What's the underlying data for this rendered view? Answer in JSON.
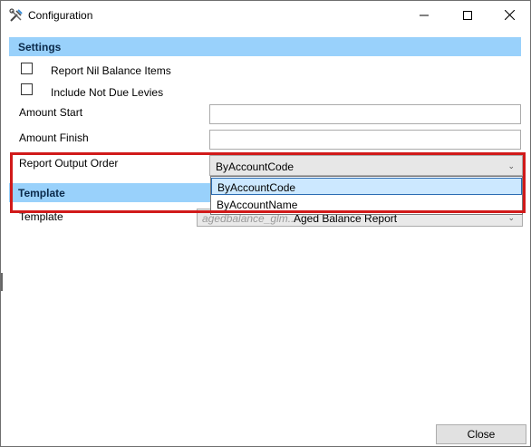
{
  "window": {
    "title": "Configuration"
  },
  "settings": {
    "header": "Settings",
    "report_nil_balance": {
      "label": "Report Nil Balance Items",
      "checked": false
    },
    "include_not_due": {
      "label": "Include Not Due Levies",
      "checked": false
    },
    "amount_start": {
      "label": "Amount Start",
      "value": ""
    },
    "amount_finish": {
      "label": "Amount Finish",
      "value": ""
    },
    "report_output_order": {
      "label": "Report Output Order",
      "selected": "ByAccountCode",
      "options": [
        "ByAccountCode",
        "ByAccountName"
      ]
    }
  },
  "template": {
    "header": "Template",
    "label": "Template",
    "file_prefix": "agedbalance_glm...",
    "name": "Aged Balance Report"
  },
  "footer": {
    "close_label": "Close"
  },
  "colors": {
    "section_header": "#99d1fb",
    "highlight": "#d11a1a",
    "selected_item": "#cce8ff"
  }
}
